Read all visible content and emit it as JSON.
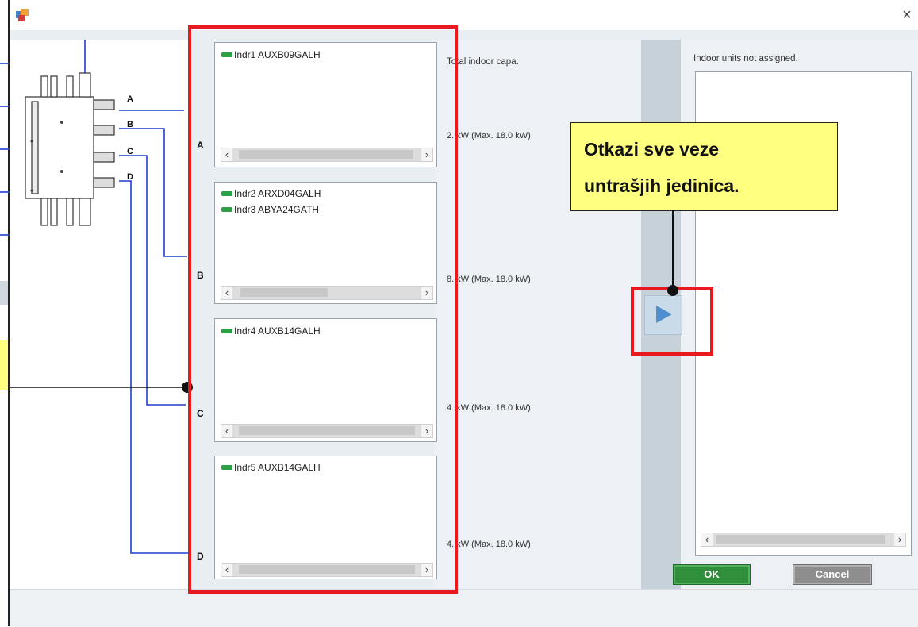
{
  "dialog": {
    "close_glyph": "×"
  },
  "ports": [
    {
      "letter": "A",
      "unit_lines": [
        "Indr1 AUXB09GALH"
      ],
      "capacity": "2.  kW (Max. 18.0 kW)"
    },
    {
      "letter": "B",
      "unit_lines": [
        "Indr2 ARXD04GALH",
        "Indr3 ABYA24GATH"
      ],
      "capacity": "8.  kW (Max. 18.0 kW)"
    },
    {
      "letter": "C",
      "unit_lines": [
        "Indr4 AUXB14GALH"
      ],
      "capacity": "4.  kW (Max. 18.0 kW)"
    },
    {
      "letter": "D",
      "unit_lines": [
        "Indr5 AUXB14GALH"
      ],
      "capacity": "4.  kW (Max. 18.0 kW)"
    }
  ],
  "center": {
    "total_capa_label": "Total indoor capa."
  },
  "right": {
    "unassigned_label": "Indoor units not assigned."
  },
  "callout": {
    "line1": "Otkazi sve veze",
    "line2": "untrašjih jedinica."
  },
  "buttons": {
    "ok": "OK",
    "cancel": "Cancel"
  },
  "scroll_glyphs": {
    "left": "‹",
    "right": "›"
  },
  "colors": {
    "highlight_red": "#e8191f",
    "callout_yellow": "#ffff80",
    "wire_blue": "#1f3fd1",
    "unit_green": "#2da045",
    "ok_green": "#2f8f3a"
  },
  "icons": [
    "app-icon",
    "close-icon",
    "unit-icon",
    "unassign-arrow-icon",
    "scroll-left-icon",
    "scroll-right-icon"
  ]
}
